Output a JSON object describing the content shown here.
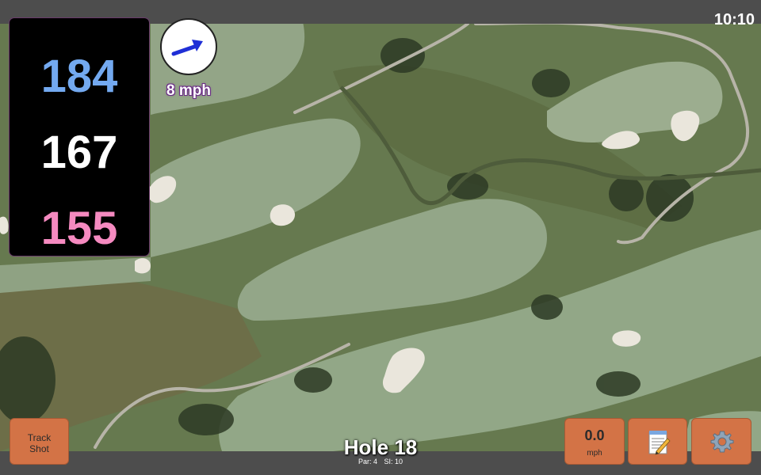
{
  "status": {
    "time": "10:10"
  },
  "distances": {
    "back": "184",
    "middle": "167",
    "front": "155"
  },
  "wind": {
    "speed_label": "8 mph",
    "icon": "wind-direction-arrow-icon"
  },
  "buttons": {
    "track_shot": [
      "Track",
      "Shot"
    ],
    "speed": {
      "value": "0.0",
      "unit": "mph"
    },
    "notes_icon": "notepad-icon",
    "settings_icon": "gear-icon"
  },
  "hole": {
    "title": "Hole 18",
    "par": "Par: 4",
    "si": "SI: 10"
  },
  "colors": {
    "back_distance": "#73a9f0",
    "middle_distance": "#ffffff",
    "front_distance": "#f58ac0",
    "button": "#d37346",
    "wind_arrow": "#1f2fd6"
  }
}
